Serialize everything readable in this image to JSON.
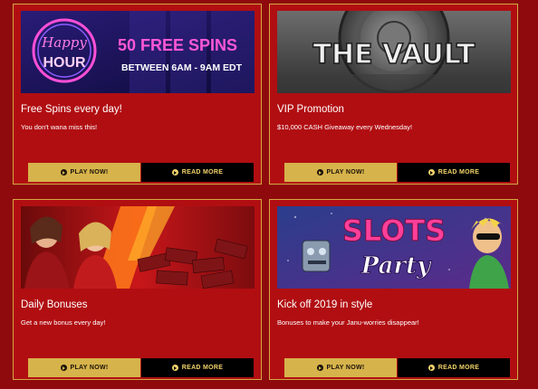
{
  "promotions": [
    {
      "title": "Free Spins every day!",
      "description": "You don't wana miss this!",
      "banner": {
        "neon_line1": "Happy",
        "neon_line2": "HOUR",
        "headline": "50 FREE SPINS",
        "subline": "BETWEEN 6AM - 9AM EDT"
      },
      "play_label": "PLAY NOW!",
      "read_label": "READ MORE"
    },
    {
      "title": "VIP Promotion",
      "description": "$10,000 CASH Giveaway every Wednesday!",
      "banner": {
        "headline": "THE VAULT"
      },
      "play_label": "PLAY NOW!",
      "read_label": "READ MORE"
    },
    {
      "title": "Daily Bonuses",
      "description": "Get a new bonus every day!",
      "play_label": "PLAY NOW!",
      "read_label": "READ MORE"
    },
    {
      "title": "Kick off 2019 in style",
      "description": "Bonuses to make your Janu-worries disappear!",
      "banner": {
        "line1": "SLOTS",
        "line2": "Party"
      },
      "play_label": "PLAY NOW!",
      "read_label": "READ MORE"
    }
  ],
  "colors": {
    "page_background": "#8e0a0c",
    "card_background": "#b10e12",
    "card_border": "#d4a843",
    "play_button": "#d6b34b",
    "read_button": "#000000",
    "read_button_text": "#f2d36a"
  },
  "icons": {
    "button_icon": "circle-play-icon"
  }
}
